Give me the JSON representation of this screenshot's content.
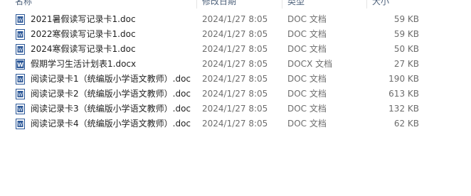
{
  "columns": {
    "name": "名称",
    "date": "修改日期",
    "type": "类型",
    "size": "大小"
  },
  "files": [
    {
      "name": "2021暑假读写记录卡1.doc",
      "date": "2024/1/27 8:05",
      "type": "DOC 文档",
      "size": "59 KB",
      "icon": "word-doc-icon"
    },
    {
      "name": "2022寒假读写记录卡1.doc",
      "date": "2024/1/27 8:05",
      "type": "DOC 文档",
      "size": "59 KB",
      "icon": "word-doc-icon"
    },
    {
      "name": "2024寒假读写记录卡1.doc",
      "date": "2024/1/27 8:05",
      "type": "DOC 文档",
      "size": "50 KB",
      "icon": "word-doc-icon"
    },
    {
      "name": "假期学习生活计划表1.docx",
      "date": "2024/1/27 8:05",
      "type": "DOCX 文档",
      "size": "27 KB",
      "icon": "word-docx-icon"
    },
    {
      "name": "阅读记录卡1（统编版小学语文教师）.doc",
      "date": "2024/1/27 8:05",
      "type": "DOC 文档",
      "size": "190 KB",
      "icon": "word-doc-icon"
    },
    {
      "name": "阅读记录卡2（统编版小学语文教师）.doc",
      "date": "2024/1/27 8:05",
      "type": "DOC 文档",
      "size": "613 KB",
      "icon": "word-doc-icon"
    },
    {
      "name": "阅读记录卡3（统编版小学语文教师）.doc",
      "date": "2024/1/27 8:05",
      "type": "DOC 文档",
      "size": "132 KB",
      "icon": "word-doc-icon"
    },
    {
      "name": "阅读记录卡4（统编版小学语文教师）.doc",
      "date": "2024/1/27 8:05",
      "type": "DOC 文档",
      "size": "62 KB",
      "icon": "word-doc-icon"
    }
  ],
  "colors": {
    "icon_blue": "#2b5797",
    "header_text": "#4c607a",
    "detail_text": "#6d6d6d"
  }
}
